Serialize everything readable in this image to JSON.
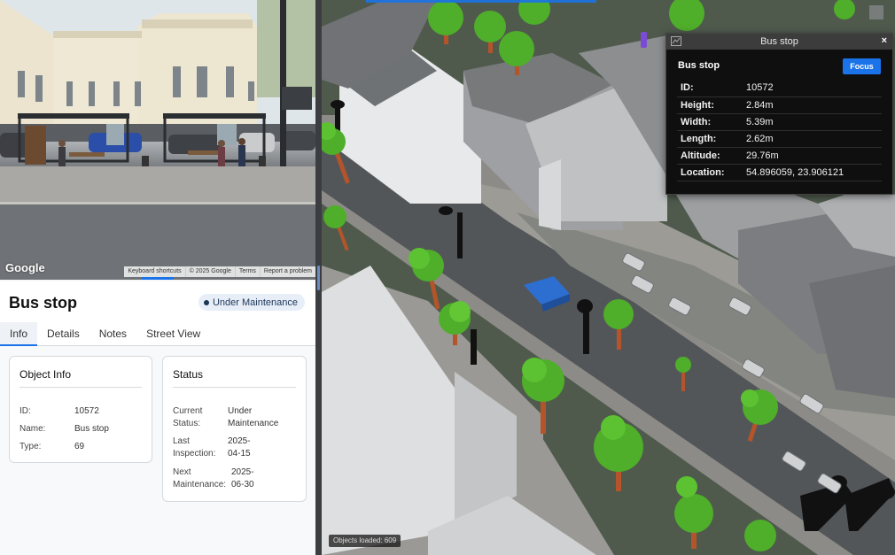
{
  "street_view": {
    "logo": "Google",
    "footer": [
      "Keyboard shortcuts",
      "© 2025 Google",
      "Terms",
      "Report a problem"
    ]
  },
  "object": {
    "title": "Bus stop",
    "status_badge": "Under Maintenance"
  },
  "tabs": [
    {
      "label": "Info",
      "active": true
    },
    {
      "label": "Details",
      "active": false
    },
    {
      "label": "Notes",
      "active": false
    },
    {
      "label": "Street View",
      "active": false
    }
  ],
  "object_info": {
    "heading": "Object Info",
    "rows": [
      {
        "key": "ID:",
        "value": "10572"
      },
      {
        "key": "Name:",
        "value": "Bus stop"
      },
      {
        "key": "Type:",
        "value": "69"
      }
    ]
  },
  "status_card": {
    "heading": "Status",
    "rows": [
      {
        "key": "Current Status:",
        "value": "Under Maintenance"
      },
      {
        "key": "Last Inspection:",
        "value": "2025-04-15"
      },
      {
        "key": "Next Maintenance:",
        "value": "2025-06-30"
      }
    ]
  },
  "map": {
    "objects_loaded": "Objects loaded: 609"
  },
  "popup": {
    "title": "Bus stop",
    "subtitle": "Bus stop",
    "focus_label": "Focus",
    "close_label": "×",
    "rows": [
      {
        "key": "ID:",
        "value": "10572"
      },
      {
        "key": "Height:",
        "value": "2.84m"
      },
      {
        "key": "Width:",
        "value": "5.39m"
      },
      {
        "key": "Length:",
        "value": "2.62m"
      },
      {
        "key": "Altitude:",
        "value": "29.76m"
      },
      {
        "key": "Location:",
        "value": "54.896059, 23.906121"
      }
    ]
  },
  "colors": {
    "accent": "#1a73e8",
    "status_dark": "#1c3557",
    "tree": "#4fae2a",
    "trunk": "#b4542a",
    "bus_shelter": "#2d6fd0"
  }
}
